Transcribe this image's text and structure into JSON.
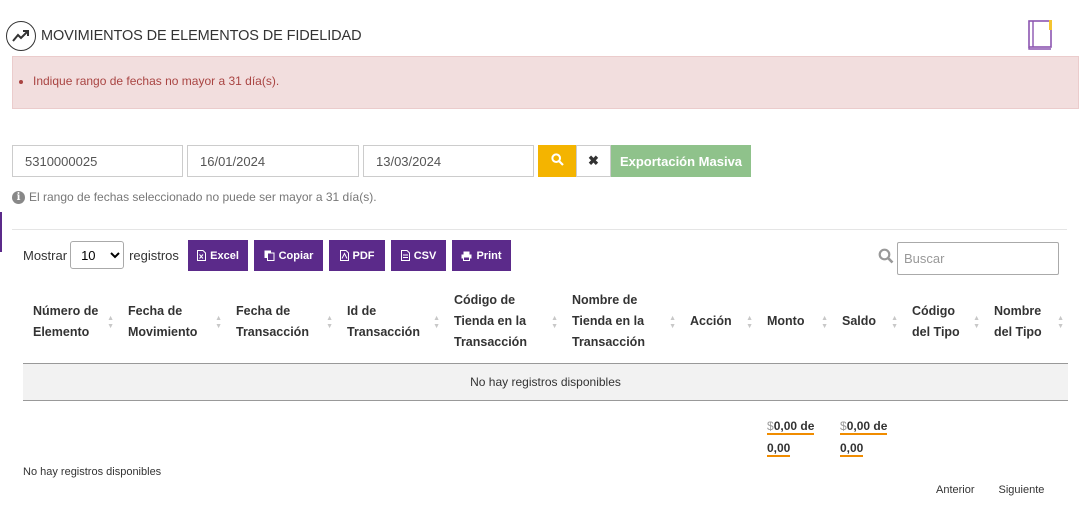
{
  "page": {
    "title": "MOVIMIENTOS DE ELEMENTOS DE FIDELIDAD",
    "title_icon": "trending-chart-icon",
    "corner_icon": "book-icon"
  },
  "alert": {
    "message": "Indique rango de fechas no mayor a 31 día(s).",
    "color": "#a94442",
    "background": "#f2dede"
  },
  "filters": {
    "element_number": "5310000025",
    "date_from": "16/01/2024",
    "date_to": "13/03/2024",
    "search_icon": "search-icon",
    "clear_icon": "close-icon",
    "export_label": "Exportación Masiva"
  },
  "hint": {
    "text": "El rango de fechas seleccionado no puede ser mayor a 31 día(s).",
    "icon": "info-icon"
  },
  "table_controls": {
    "show_label": "Mostrar",
    "page_size": "10",
    "records_label": "registros",
    "buttons": [
      {
        "label": "Excel",
        "icon": "excel-icon"
      },
      {
        "label": "Copiar",
        "icon": "copy-icon"
      },
      {
        "label": "PDF",
        "icon": "pdf-icon"
      },
      {
        "label": "CSV",
        "icon": "csv-icon"
      },
      {
        "label": "Print",
        "icon": "print-icon"
      }
    ],
    "search_placeholder": "Buscar",
    "accent_color": "#5b2a8a"
  },
  "table": {
    "columns": [
      "Número de Elemento",
      "Fecha de Movimiento",
      "Fecha de Transacción",
      "Id de Transacción",
      "Código de Tienda en la Transacción",
      "Nombre de Tienda en la Transacción",
      "Acción",
      "Monto",
      "Saldo",
      "Código del Tipo",
      "Nombre del Tipo"
    ],
    "empty_message": "No hay registros disponibles"
  },
  "totals": {
    "monto": "0,00 de 0,00",
    "saldo": "0,00 de 0,00",
    "currency": "$"
  },
  "footer": {
    "info": "No hay registros disponibles",
    "prev": "Anterior",
    "next": "Siguiente"
  }
}
